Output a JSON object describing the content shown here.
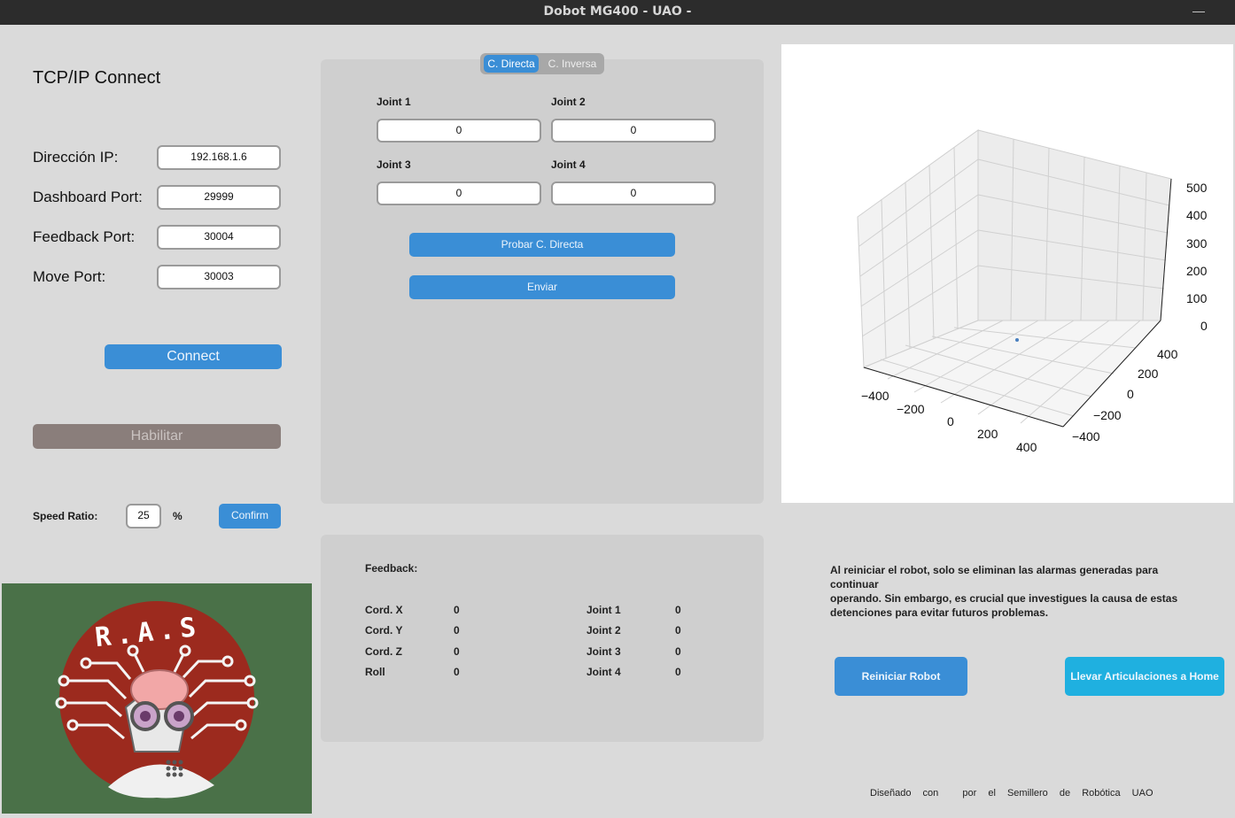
{
  "window": {
    "title": "Dobot MG400 - UAO -",
    "minimize_icon": "minimize-icon"
  },
  "connect_panel": {
    "heading": "TCP/IP Connect",
    "fields": [
      {
        "label": "Dirección IP:",
        "value": "192.168.1.6"
      },
      {
        "label": "Dashboard Port:",
        "value": "29999"
      },
      {
        "label": "Feedback Port:",
        "value": "30004"
      },
      {
        "label": "Move Port:",
        "value": "30003"
      }
    ],
    "connect_label": "Connect",
    "enable_label": "Habilitar",
    "speed": {
      "label": "Speed Ratio:",
      "value": "25",
      "unit": "%",
      "confirm_label": "Confirm"
    }
  },
  "kinematics": {
    "tabs": [
      {
        "label": "C. Directa",
        "selected": true
      },
      {
        "label": "C. Inversa",
        "selected": false
      }
    ],
    "joints": [
      {
        "label": "Joint 1",
        "value": "0"
      },
      {
        "label": "Joint 2",
        "value": "0"
      },
      {
        "label": "Joint 3",
        "value": "0"
      },
      {
        "label": "Joint 4",
        "value": "0"
      }
    ],
    "test_label": "Probar C. Directa",
    "send_label": "Enviar"
  },
  "feedback": {
    "title": "Feedback:",
    "coords": [
      {
        "label": "Cord. X",
        "value": "0"
      },
      {
        "label": "Cord. Y",
        "value": "0"
      },
      {
        "label": "Cord. Z",
        "value": "0"
      },
      {
        "label": "Roll",
        "value": "0"
      }
    ],
    "joints": [
      {
        "label": "Joint 1",
        "value": "0"
      },
      {
        "label": "Joint 2",
        "value": "0"
      },
      {
        "label": "Joint 3",
        "value": "0"
      },
      {
        "label": "Joint 4",
        "value": "0"
      }
    ]
  },
  "plot3d": {
    "z_ticks": [
      "500",
      "400",
      "300",
      "200",
      "100",
      "0"
    ],
    "x_ticks": [
      "−400",
      "−200",
      "0",
      "200",
      "400"
    ],
    "y_ticks": [
      "400",
      "200",
      "0",
      "−200",
      "−400"
    ]
  },
  "reset": {
    "notice_lines": [
      "Al reiniciar el robot, solo se eliminan las alarmas generadas para continuar",
      "operando. Sin embargo, es crucial que investigues la causa de estas",
      "detenciones para evitar futuros problemas."
    ],
    "reset_label": "Reiniciar Robot",
    "home_label": "Llevar Articulaciones a Home"
  },
  "footer": {
    "words": [
      "Diseñado",
      "con",
      "por",
      "el",
      "Semillero",
      "de",
      "Robótica",
      "UAO"
    ]
  },
  "logo": {
    "text": "R.A.S"
  },
  "colors": {
    "accent": "#3a8ed6",
    "home_button": "#1fb0e0",
    "disabled_button": "#8a7e7b",
    "logo_bg": "#4a7148",
    "logo_circle": "#9c2a1e"
  }
}
